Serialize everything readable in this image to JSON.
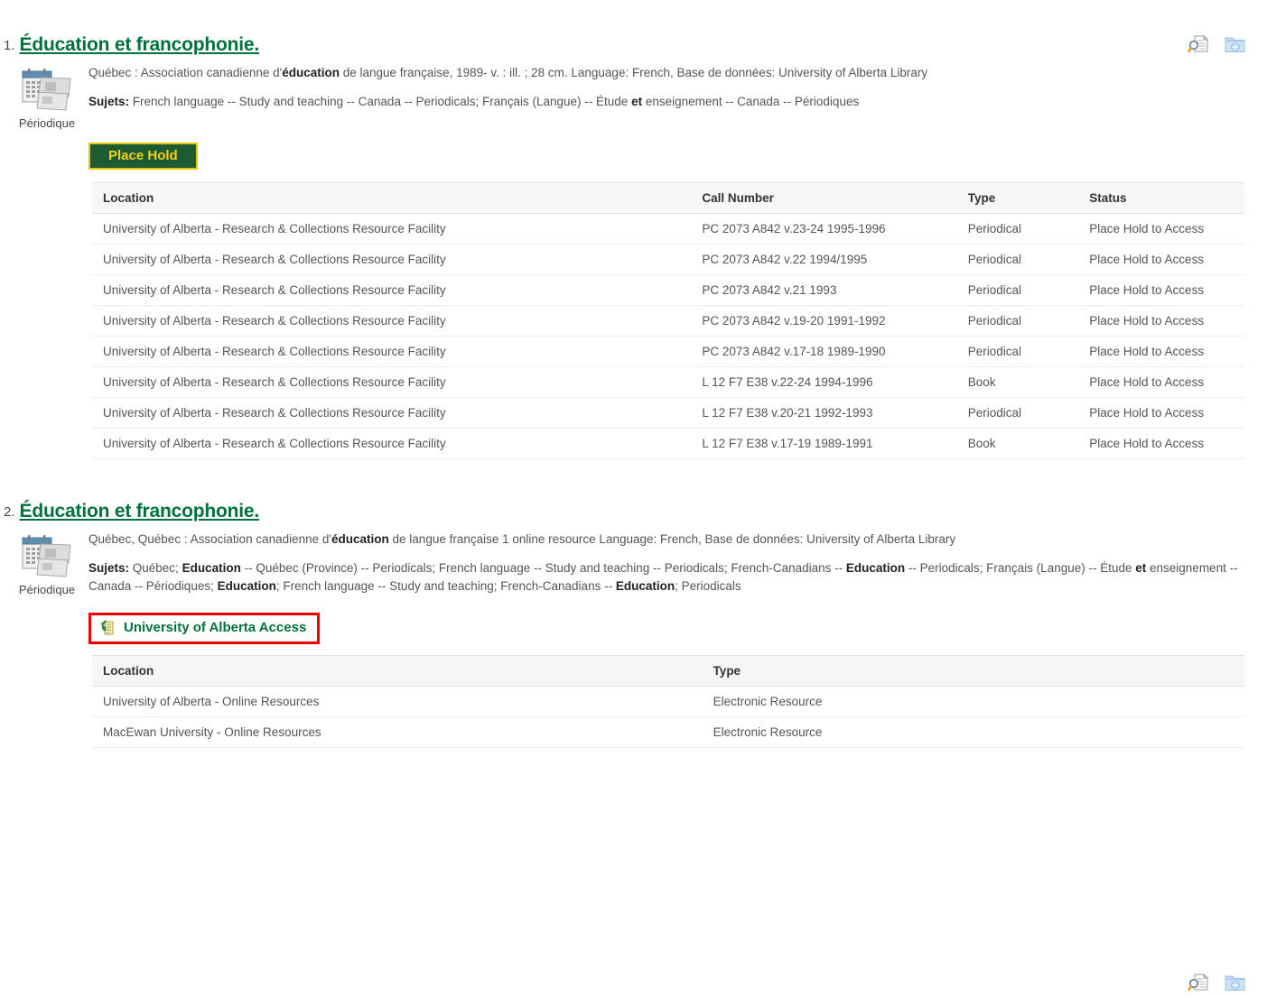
{
  "results": [
    {
      "number": "1.",
      "title": "Éducation et francophonie",
      "title_period": ".",
      "thumb_label": "Périodique",
      "thumb_icon": "periodical-icon",
      "meta_prefix": "Québec : Association canadienne d'",
      "meta_bold": "éducation",
      "meta_suffix": " de langue française, 1989- v. : ill. ; 28 cm. Language: French, Base de données: University of Alberta Library",
      "subjects_label": "Sujets:",
      "subjects_text": " French language -- Study and teaching -- Canada -- Periodicals; Français (Langue) -- Étude et enseignement -- Canada -- Périodiques",
      "action_button": "Place Hold",
      "icons": {
        "preview": "preview-document-icon",
        "add_folder": "add-to-folder-icon"
      },
      "table": {
        "headers": [
          "Location",
          "Call Number",
          "Type",
          "Status"
        ],
        "rows": [
          [
            "University of Alberta - Research & Collections Resource Facility",
            "PC 2073 A842 v.23-24 1995-1996",
            "Periodical",
            "Place Hold to Access"
          ],
          [
            "University of Alberta - Research & Collections Resource Facility",
            "PC 2073 A842 v.22 1994/1995",
            "Periodical",
            "Place Hold to Access"
          ],
          [
            "University of Alberta - Research & Collections Resource Facility",
            "PC 2073 A842 v.21 1993",
            "Periodical",
            "Place Hold to Access"
          ],
          [
            "University of Alberta - Research & Collections Resource Facility",
            "PC 2073 A842 v.19-20 1991-1992",
            "Periodical",
            "Place Hold to Access"
          ],
          [
            "University of Alberta - Research & Collections Resource Facility",
            "PC 2073 A842 v.17-18 1989-1990",
            "Periodical",
            "Place Hold to Access"
          ],
          [
            "University of Alberta - Research & Collections Resource Facility",
            "L 12 F7 E38 v.22-24 1994-1996",
            "Book",
            "Place Hold to Access"
          ],
          [
            "University of Alberta - Research & Collections Resource Facility",
            "L 12 F7 E38 v.20-21 1992-1993",
            "Periodical",
            "Place Hold to Access"
          ],
          [
            "University of Alberta - Research & Collections Resource Facility",
            "L 12 F7 E38 v.17-19 1989-1991",
            "Book",
            "Place Hold to Access"
          ]
        ]
      }
    },
    {
      "number": "2.",
      "title": "Éducation et francophonie",
      "title_period": ".",
      "thumb_label": "Périodique",
      "thumb_icon": "periodical-icon",
      "meta_prefix": "Québec, Québec : Association canadienne d'",
      "meta_bold": "éducation",
      "meta_suffix": " de langue française 1 online resource Language: French, Base de données: University of Alberta Library",
      "subjects_label": "Sujets:",
      "subjects_text": " Québec; Education -- Québec (Province) -- Periodicals; French language -- Study and teaching -- Periodicals; French-Canadians -- Education -- Periodicals; Français (Langue) -- Étude et enseignement -- Canada -- Périodiques; Education; French language -- Study and teaching; French-Canadians -- Education; Periodicals",
      "action_button": "University of Alberta Access",
      "action_icon": "document-link-icon",
      "icons": {
        "preview": "preview-document-icon",
        "add_folder": "add-to-folder-icon"
      },
      "table": {
        "headers": [
          "Location",
          "Type"
        ],
        "rows": [
          [
            "University of Alberta - Online Resources",
            "Electronic Resource"
          ],
          [
            "MacEwan University - Online Resources",
            "Electronic Resource"
          ]
        ]
      }
    }
  ],
  "colors": {
    "link_green": "#00713c",
    "hold_button_bg": "#1d5c32",
    "hold_button_border": "#e8c60a",
    "hold_button_text": "#f2cf1b",
    "highlight_red": "#ee0000",
    "table_header_bg": "#f6f6f6"
  }
}
